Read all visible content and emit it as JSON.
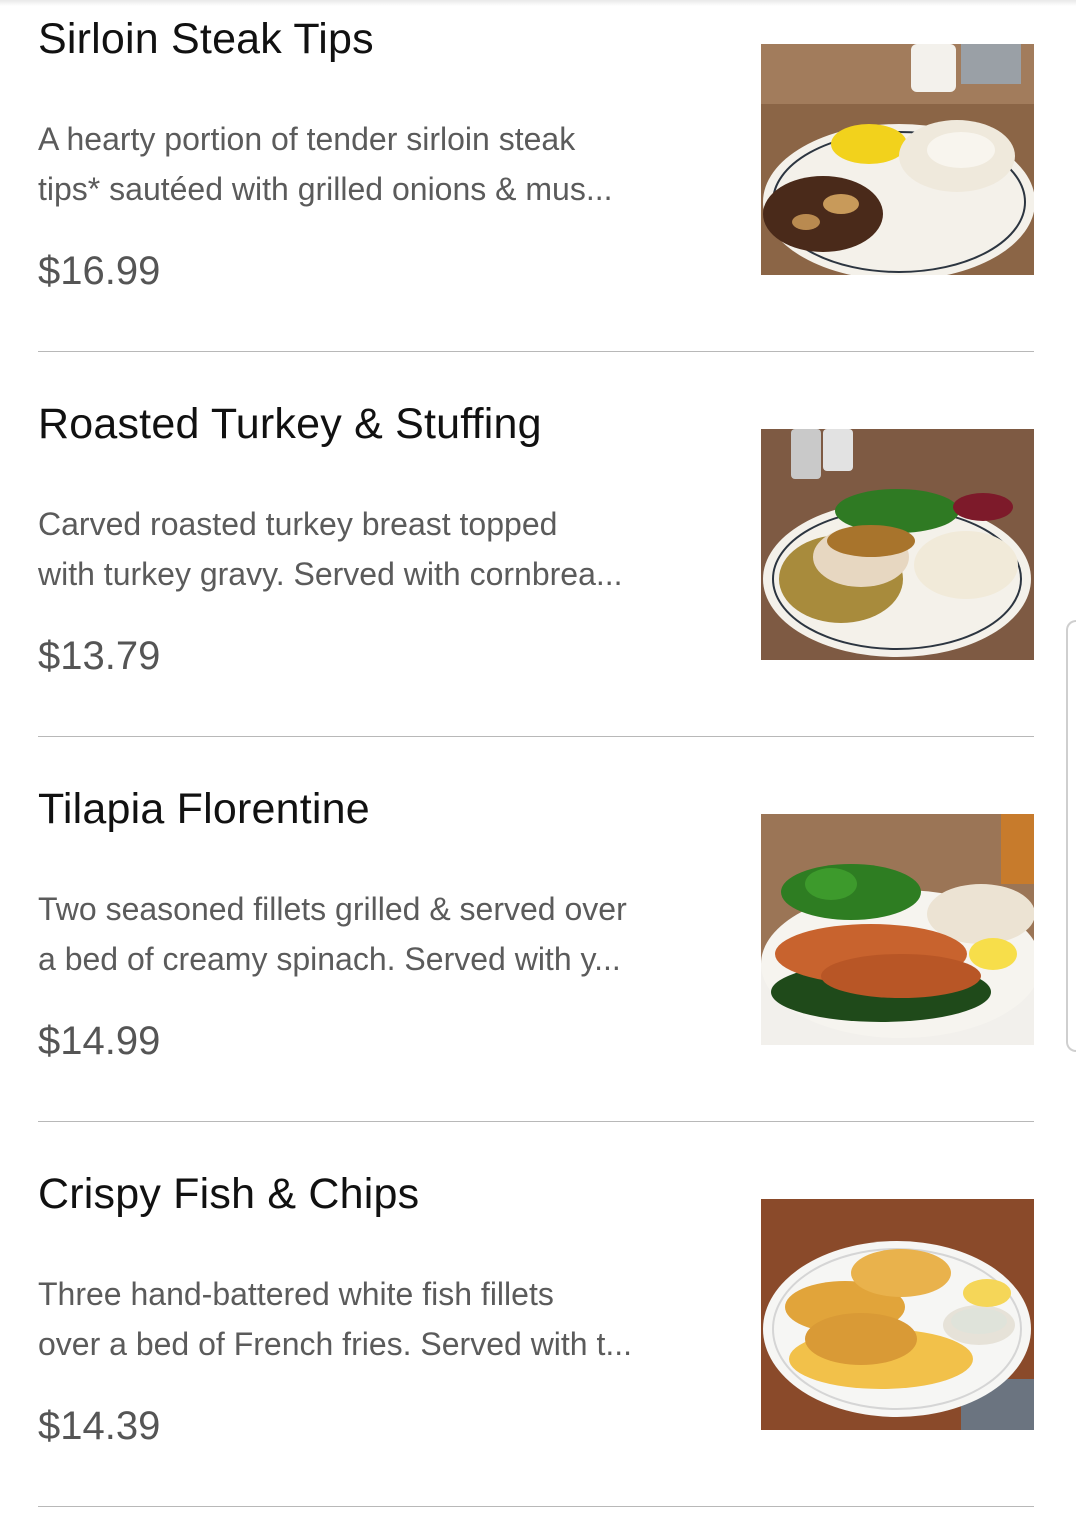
{
  "menu": {
    "items": [
      {
        "title": "Sirloin Steak Tips",
        "desc_line1": "A hearty portion of tender sirloin steak",
        "desc_line2": "tips* sautéed with grilled onions & mus...",
        "price": "$16.99",
        "image_icon": "steak-tips-plate-photo"
      },
      {
        "title": "Roasted Turkey & Stuffing",
        "desc_line1": "Carved roasted turkey breast topped",
        "desc_line2": "with turkey gravy. Served with cornbrea...",
        "price": "$13.79",
        "image_icon": "turkey-stuffing-plate-photo"
      },
      {
        "title": "Tilapia Florentine",
        "desc_line1": "Two seasoned fillets grilled & served over",
        "desc_line2": "a bed of creamy spinach. Served with y...",
        "price": "$14.99",
        "image_icon": "tilapia-plate-photo"
      },
      {
        "title": "Crispy Fish & Chips",
        "desc_line1": "Three hand-battered white fish fillets",
        "desc_line2": "over a bed of French fries. Served with t...",
        "price": "$14.39",
        "image_icon": "fish-chips-plate-photo"
      }
    ]
  },
  "colors": {
    "title_text": "#111111",
    "desc_text": "#5b5b5b",
    "price_text": "#555555",
    "divider": "#b8b8b8"
  }
}
